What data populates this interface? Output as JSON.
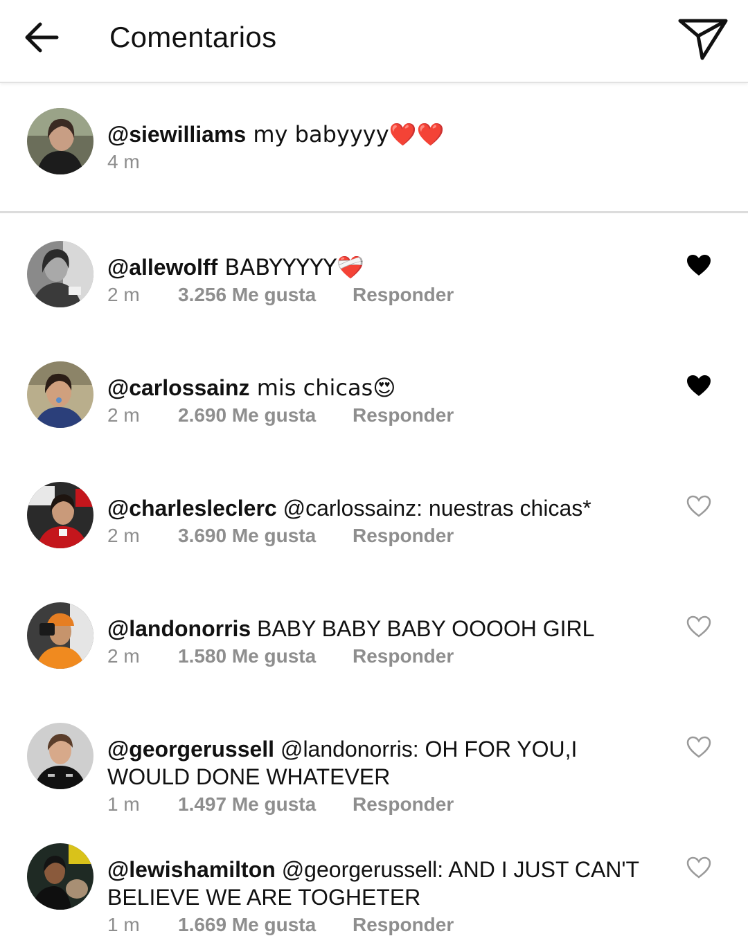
{
  "header": {
    "title": "Comentarios",
    "back_icon": "arrow-left-icon",
    "send_icon": "paper-plane-icon"
  },
  "caption": {
    "username": "@siewilliams",
    "text": " my babyyyy❤️❤️",
    "time": "4 m"
  },
  "reply_label": "Responder",
  "comments": [
    {
      "username": "@allewolff",
      "text": " BABYYYYY❤️‍🩹",
      "time": "2 m",
      "likes": "3.256 Me gusta",
      "liked": true
    },
    {
      "username": "@carlossainz",
      "text": " mis chicas😍",
      "time": "2 m",
      "likes": "2.690 Me gusta",
      "liked": true
    },
    {
      "username": "@charlesleclerc",
      "text": " @carlossainz: nuestras chicas*",
      "time": "2 m",
      "likes": "3.690 Me gusta",
      "liked": false
    },
    {
      "username": "@landonorris",
      "text": " BABY BABY BABY OOOOH GIRL",
      "time": "2 m",
      "likes": "1.580 Me gusta",
      "liked": false
    },
    {
      "username": "@georgerussell",
      "text": " @landonorris: OH FOR YOU,I WOULD DONE WHATEVER",
      "time": "1 m",
      "likes": "1.497 Me gusta",
      "liked": false
    },
    {
      "username": "@lewishamilton",
      "text": " @georgerussell: AND I JUST CAN'T BELIEVE WE ARE TOGHETER",
      "time": "1 m",
      "likes": "1.669 Me gusta",
      "liked": false
    }
  ],
  "colors": {
    "meta_gray": "#8e8e8e",
    "divider": "#dcdcdc",
    "heart_filled": "#000000",
    "heart_outline": "#9a9a9a"
  }
}
